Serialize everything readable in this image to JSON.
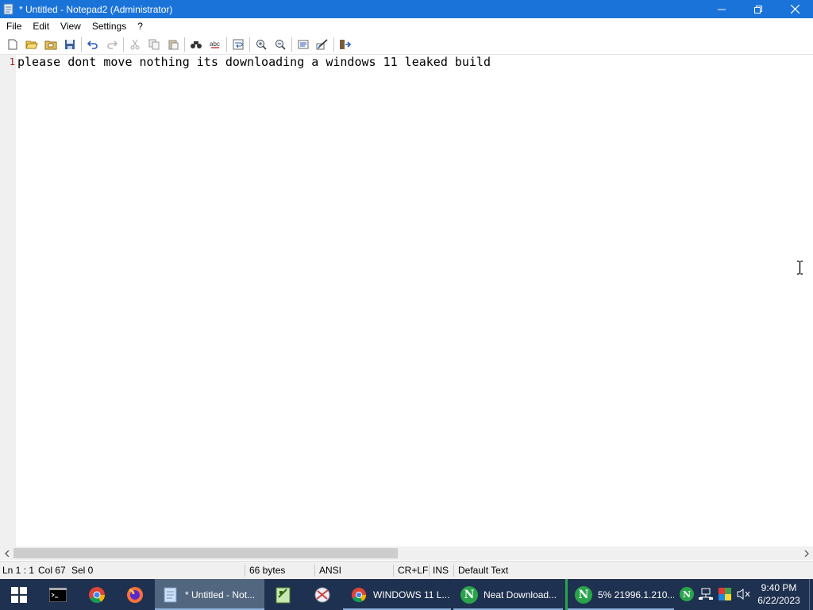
{
  "window": {
    "title": "* Untitled - Notepad2 (Administrator)"
  },
  "menu": [
    "File",
    "Edit",
    "View",
    "Settings",
    "?"
  ],
  "toolbar_icons": [
    "new-file-icon",
    "open-file-icon",
    "browse-icon",
    "save-icon",
    "undo-icon",
    "redo-icon",
    "cut-icon",
    "copy-icon",
    "paste-icon",
    "find-icon",
    "replace-icon",
    "word-wrap-icon",
    "zoom-in-icon",
    "zoom-out-icon",
    "scheme-icon",
    "settings-icon",
    "exit-icon"
  ],
  "editor": {
    "line_number": "1",
    "line_text": "please dont move nothing its downloading a windows 11 leaked build"
  },
  "status": {
    "position": "Ln 1 : 1",
    "column": "Col 67",
    "selection": "Sel 0",
    "size": "66 bytes",
    "encoding": "ANSI",
    "line_endings": "CR+LF",
    "mode": "INS",
    "scheme": "Default Text"
  },
  "taskbar": {
    "tasks": {
      "notepad": "* Untitled - Not...",
      "chrome_window": "WINDOWS 11 L...",
      "neat_download": "Neat Download...",
      "download_progress": "5%  21996.1.210..."
    },
    "clock_time": "9:40 PM",
    "clock_date": "6/22/2023"
  },
  "colors": {
    "titlebar": "#1a73d9",
    "taskbar": "#1f3150",
    "active_task": "#52677f",
    "line_number": "#a12020"
  }
}
